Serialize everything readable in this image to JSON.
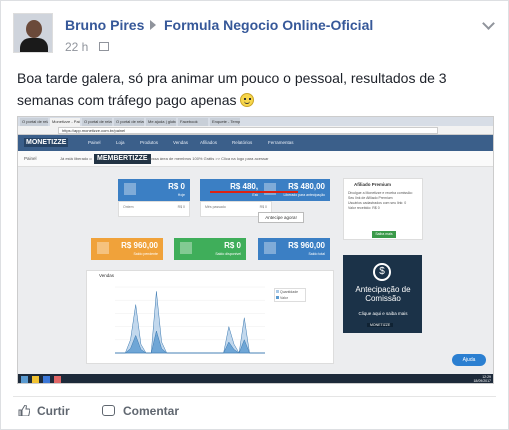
{
  "post": {
    "author": "Bruno Pires",
    "group": "Formula Negocio Online-Oficial",
    "time": "22 h",
    "text": "Boa tarde galera, só pra animar um pouco o pessoal, resultados de 3 semanas com tráfego pago apenas"
  },
  "screenshot": {
    "tabs": [
      "O portal de relató",
      "Monetizze - Painel",
      "O portal de relató",
      "O portal de relató",
      "Me ajuda | globosp",
      "Facebook",
      "Enquete - Templates"
    ],
    "url": "https://app.monetizze.com.br/painel",
    "app_logo": "MONETIZZE",
    "nav": [
      "Painel",
      "Loja",
      "Produtos",
      "Vendas",
      "Afiliados",
      "Relatórios",
      "Ferramentas"
    ],
    "breadcrumb": "Painel",
    "promo_left": "Já está liberado o",
    "promo_brand": "MEMBERTIZZE",
    "promo_right": "nossa área de membros 100% Grátis >> Clica na logo para acessar",
    "tiles": [
      {
        "value": "R$ 0",
        "label": "Hoje",
        "foot_a": "Ontem",
        "foot_b": "R$ 0",
        "color": "#3b7fc4"
      },
      {
        "value": "R$ 480,00",
        "label": "Este mês",
        "foot_a": "Mês passado",
        "foot_b": "R$ 0",
        "color": "#3b7fc4"
      },
      {
        "value": "R$ 480,00",
        "label": "Liberado para antecipação",
        "foot_a": "",
        "foot_b": "",
        "color": "#3b7fc4"
      },
      {
        "value": "R$ 960,00",
        "label": "Saldo pendente",
        "color": "#f0a23a"
      },
      {
        "value": "R$ 0",
        "label": "Saldo disponível",
        "color": "#3fae5a"
      },
      {
        "value": "R$ 960,00",
        "label": "Saldo total",
        "color": "#3b7fc4"
      }
    ],
    "anticipate_button": "Antecipe agora!",
    "affiliate": {
      "title": "Afiliado Premium",
      "desc": "Divulgue a Monetizze e receba comissão:",
      "line2": "Seu link de Afiliado Premium",
      "line3": "Usuários cadastrados com seu link: 0",
      "line4": "Valor recebido: R$ 0",
      "button": "Saiba mais"
    },
    "anticipation": {
      "heading": "Antecipação de Comissão",
      "sub": "Clique aqui e saiba mais",
      "brand": "MONETIZZE"
    },
    "chart_title": "Vendas",
    "help_button": "Ajuda",
    "clock_time": "12:29",
    "clock_date": "18/09/2017"
  },
  "chart_data": {
    "type": "area",
    "title": "Vendas",
    "series": [
      {
        "name": "Quantidade",
        "color": "#a8c8e6",
        "values": [
          0,
          0,
          0,
          30,
          110,
          20,
          0,
          0,
          140,
          25,
          0,
          0,
          0,
          0,
          0,
          0,
          0,
          0,
          0,
          0,
          0,
          0,
          60,
          20,
          0,
          80,
          0,
          0,
          0,
          0
        ]
      },
      {
        "name": "Valor",
        "color": "#5a9ad0",
        "values": [
          0,
          0,
          0,
          10,
          40,
          8,
          0,
          0,
          50,
          10,
          0,
          0,
          0,
          0,
          0,
          0,
          0,
          0,
          0,
          0,
          0,
          0,
          25,
          8,
          0,
          30,
          0,
          0,
          0,
          0
        ]
      }
    ]
  },
  "actions": {
    "like": "Curtir",
    "comment": "Comentar"
  }
}
